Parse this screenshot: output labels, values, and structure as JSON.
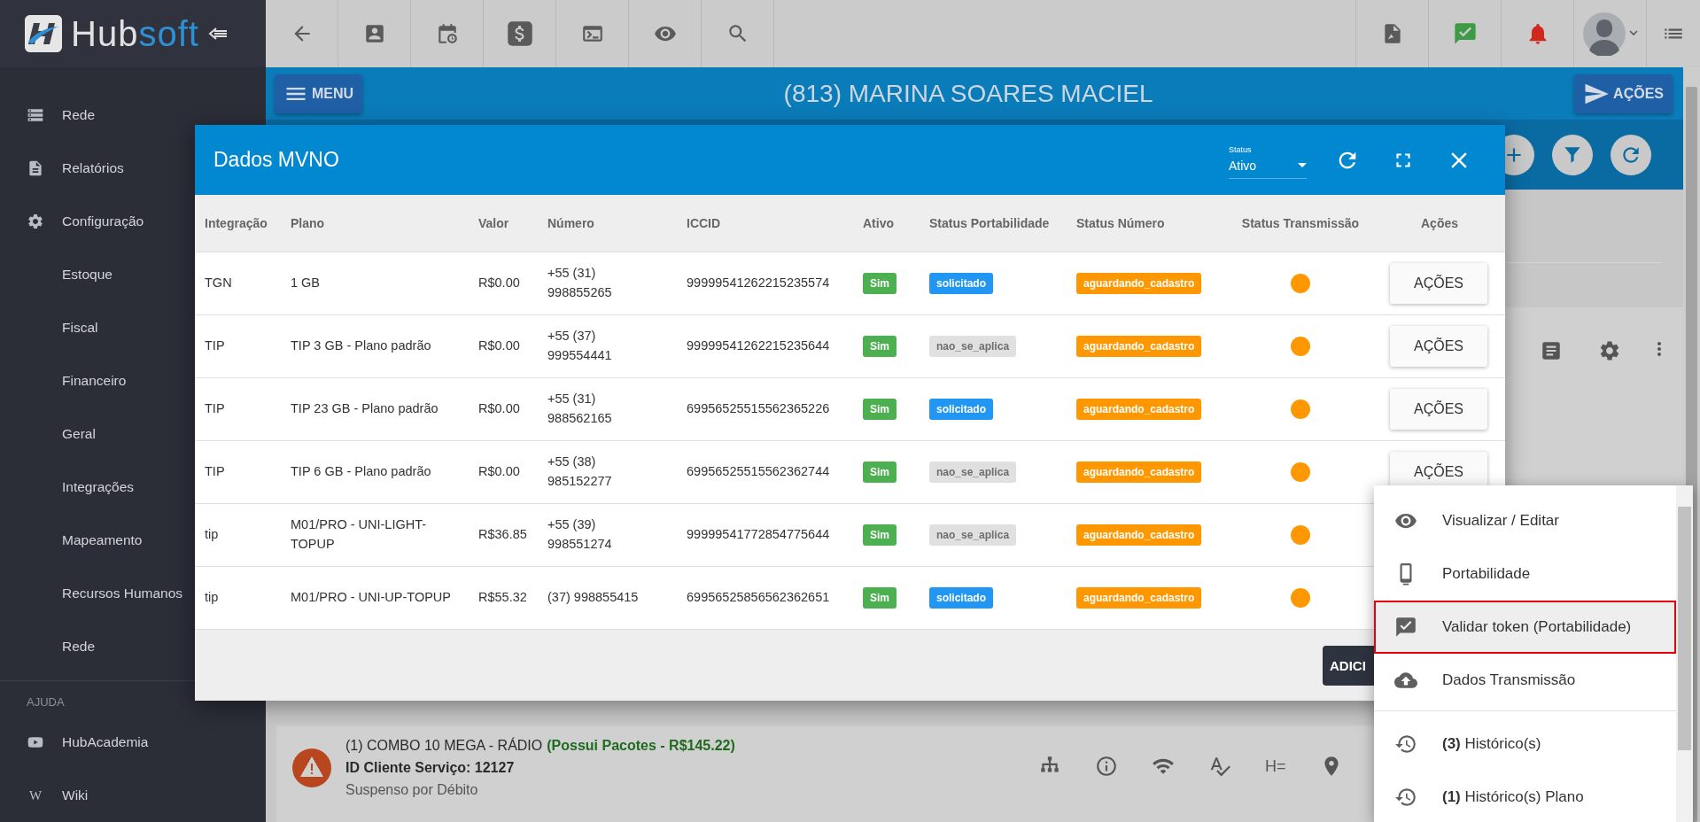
{
  "sidebar": {
    "logo": {
      "text_light": "Hub",
      "text_accent": "soft"
    },
    "items": [
      {
        "label": "Rede",
        "kind": "section"
      },
      {
        "label": "Relatórios",
        "kind": "section"
      },
      {
        "label": "Configuração",
        "kind": "section"
      },
      {
        "label": "Estoque",
        "kind": "sub"
      },
      {
        "label": "Fiscal",
        "kind": "sub"
      },
      {
        "label": "Financeiro",
        "kind": "sub"
      },
      {
        "label": "Geral",
        "kind": "sub"
      },
      {
        "label": "Integrações",
        "kind": "sub"
      },
      {
        "label": "Mapeamento",
        "kind": "sub"
      },
      {
        "label": "Recursos Humanos",
        "kind": "sub"
      },
      {
        "label": "Rede",
        "kind": "sub"
      }
    ],
    "help": {
      "heading": "AJUDA",
      "items": [
        {
          "label": "HubAcademia"
        },
        {
          "label": "Wiki",
          "icon_char": "W"
        }
      ]
    }
  },
  "header": {
    "menu_button": "MENU",
    "title": "(813) MARINA SOARES MACIEL",
    "actions_button": "AÇÕES"
  },
  "modal": {
    "title": "Dados MVNO",
    "status_filter": {
      "label": "Status",
      "value": "Ativo"
    },
    "columns": [
      "Integração",
      "Plano",
      "Valor",
      "Número",
      "ICCID",
      "Ativo",
      "Status Portabilidade",
      "Status Número",
      "Status Transmissão",
      "Ações"
    ],
    "rows": [
      {
        "integracao": "TGN",
        "plano": [
          "1 GB"
        ],
        "valor": "R$0.00",
        "numero": [
          "+55 (31)",
          "998855265"
        ],
        "iccid": "99999541262215235574",
        "ativo": {
          "label": "Sim",
          "color": "#4caf50"
        },
        "portabilidade": {
          "label": "solicitado",
          "color": "#2196f3"
        },
        "status_numero": {
          "label": "aguardando_cadastro",
          "color": "#ff9800"
        },
        "transmissao": {
          "color": "#ff9800"
        },
        "action": "AÇÕES"
      },
      {
        "integracao": "TIP",
        "plano": [
          "TIP 3 GB - Plano padrão"
        ],
        "valor": "R$0.00",
        "numero": [
          "+55 (37)",
          "999554441"
        ],
        "iccid": "99999541262215235644",
        "ativo": {
          "label": "Sim",
          "color": "#4caf50"
        },
        "portabilidade": {
          "label": "nao_se_aplica",
          "color": "#e0e0e0"
        },
        "status_numero": {
          "label": "aguardando_cadastro",
          "color": "#ff9800"
        },
        "transmissao": {
          "color": "#ff9800"
        },
        "action": "AÇÕES"
      },
      {
        "integracao": "TIP",
        "plano": [
          "TIP 23 GB - Plano padrão"
        ],
        "valor": "R$0.00",
        "numero": [
          "+55 (31)",
          "988562165"
        ],
        "iccid": "69956525515562365226",
        "ativo": {
          "label": "Sim",
          "color": "#4caf50"
        },
        "portabilidade": {
          "label": "solicitado",
          "color": "#2196f3"
        },
        "status_numero": {
          "label": "aguardando_cadastro",
          "color": "#ff9800"
        },
        "transmissao": {
          "color": "#ff9800"
        },
        "action": "AÇÕES"
      },
      {
        "integracao": "TIP",
        "plano": [
          "TIP 6 GB - Plano padrão"
        ],
        "valor": "R$0.00",
        "numero": [
          "+55 (38)",
          "985152277"
        ],
        "iccid": "69956525515562362744",
        "ativo": {
          "label": "Sim",
          "color": "#4caf50"
        },
        "portabilidade": {
          "label": "nao_se_aplica",
          "color": "#e0e0e0"
        },
        "status_numero": {
          "label": "aguardando_cadastro",
          "color": "#ff9800"
        },
        "transmissao": {
          "color": "#ff9800"
        },
        "action": "AÇÕES"
      },
      {
        "integracao": "tip",
        "plano": [
          "M01/PRO - UNI-LIGHT-",
          "TOPUP"
        ],
        "valor": "R$36.85",
        "numero": [
          "+55 (39)",
          "998551274"
        ],
        "iccid": "99999541772854775644",
        "ativo": {
          "label": "Sim",
          "color": "#4caf50"
        },
        "portabilidade": {
          "label": "nao_se_aplica",
          "color": "#e0e0e0"
        },
        "status_numero": {
          "label": "aguardando_cadastro",
          "color": "#ff9800"
        },
        "transmissao": {
          "color": "#ff9800"
        }
      },
      {
        "integracao": "tip",
        "plano": [
          "M01/PRO - UNI-UP-TOPUP"
        ],
        "valor": "R$55.32",
        "numero": [
          "(37) 998855415"
        ],
        "iccid": "69956525856562362651",
        "ativo": {
          "label": "Sim",
          "color": "#4caf50"
        },
        "portabilidade": {
          "label": "solicitado",
          "color": "#2196f3"
        },
        "status_numero": {
          "label": "aguardando_cadastro",
          "color": "#ff9800"
        },
        "transmissao": {
          "color": "#ff9800"
        }
      }
    ],
    "footer_button": "ADICI"
  },
  "action_menu": {
    "sections": [
      {
        "items": [
          {
            "label": "Visualizar / Editar",
            "highlighted": false
          },
          {
            "label": "Portabilidade",
            "highlighted": false
          },
          {
            "label": "Validar token (Portabilidade)",
            "highlighted": true
          },
          {
            "label": "Dados Transmissão",
            "highlighted": false
          }
        ]
      },
      {
        "items": [
          {
            "label": "**(3)** Histórico(s)",
            "highlighted": false
          },
          {
            "label": "**(1)** Histórico(s) Plano",
            "highlighted": false
          }
        ]
      }
    ]
  },
  "service_card": {
    "title": "(1) COMBO 10 MEGA - RÁDIO",
    "packages": "(Possui Pacotes - R$145.22)",
    "client_id": "ID Cliente Serviço: 12127",
    "status": "Suspenso por Débito",
    "tool_chars": "H="
  }
}
